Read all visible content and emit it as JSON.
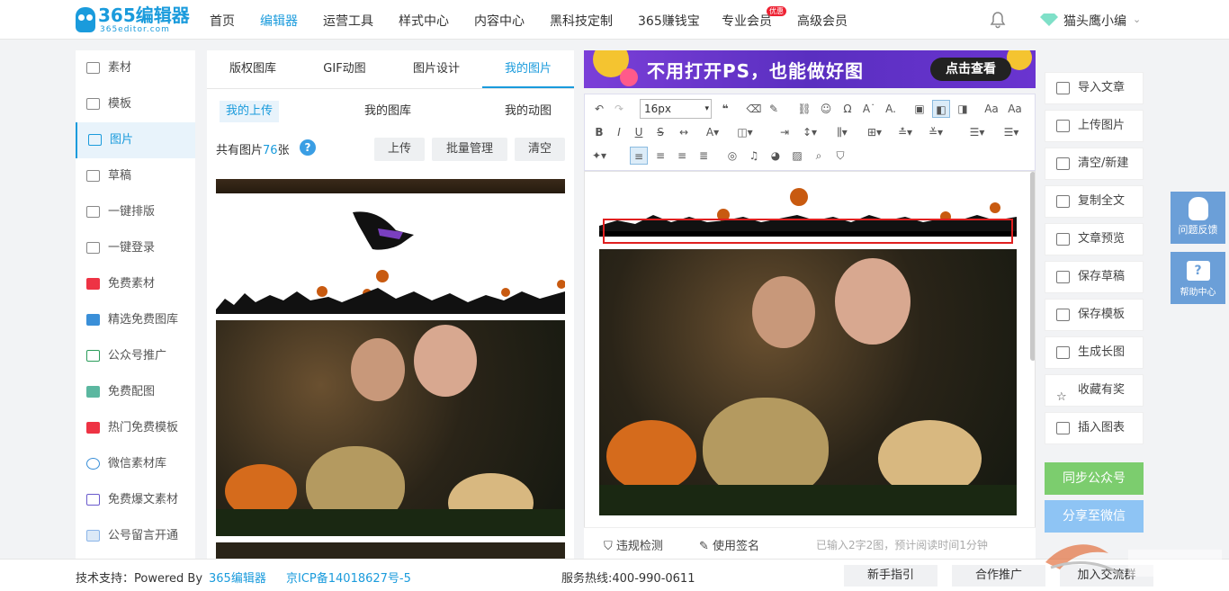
{
  "nav": {
    "logo_text": "365编辑器",
    "logo_sub": "365editor.com",
    "items": [
      "首页",
      "编辑器",
      "运营工具",
      "样式中心",
      "内容中心",
      "黑科技定制",
      "365赚钱宝",
      "专业会员",
      "高级会员"
    ],
    "badge": "优惠",
    "username": "猫头鹰小编"
  },
  "sidebar": {
    "items": [
      "素材",
      "模板",
      "图片",
      "草稿",
      "一键排版",
      "一键登录",
      "免费素材",
      "精选免费图库",
      "公众号推广",
      "免费配图",
      "热门免费模板",
      "微信素材库",
      "免费爆文素材",
      "公号留言开通"
    ]
  },
  "left_panel": {
    "tabs": [
      "版权图库",
      "GIF动图",
      "图片设计",
      "我的图片"
    ],
    "subtabs": [
      "我的上传",
      "我的图库",
      "我的动图"
    ],
    "count_prefix": "共有图片",
    "count": "76",
    "count_suffix": "张",
    "help": "?",
    "buttons": [
      "上传",
      "批量管理",
      "清空"
    ]
  },
  "banner": {
    "text": "不用打开PS，也能做好图",
    "button": "点击查看"
  },
  "toolbar": {
    "font_size": "16px"
  },
  "editor_bottom": {
    "check": "违规检测",
    "signature": "使用签名",
    "status": "已输入2字2图，预计阅读时间1分钟"
  },
  "right_panel": {
    "buttons": [
      "导入文章",
      "上传图片",
      "清空/新建",
      "复制全文",
      "文章预览",
      "保存草稿",
      "保存模板",
      "生成长图",
      "收藏有奖",
      "插入图表"
    ],
    "sync": "同步公众号",
    "share": "分享至微信",
    "float_feedback": "问题反馈",
    "float_help": "帮助中心"
  },
  "footer": {
    "support_label": "技术支持：Powered By",
    "support_link": "365编辑器",
    "icp": "京ICP备14018627号-5",
    "hotline": "服务热线:400-990-0611",
    "guide": "新手指引",
    "partner": "合作推广",
    "join": "加入交流群"
  },
  "colors": {
    "accent": "#1a9bdc",
    "sync_green": "#7ccd6e",
    "share_blue": "#8ec4f4",
    "banner_purple": "#6a34d0"
  }
}
